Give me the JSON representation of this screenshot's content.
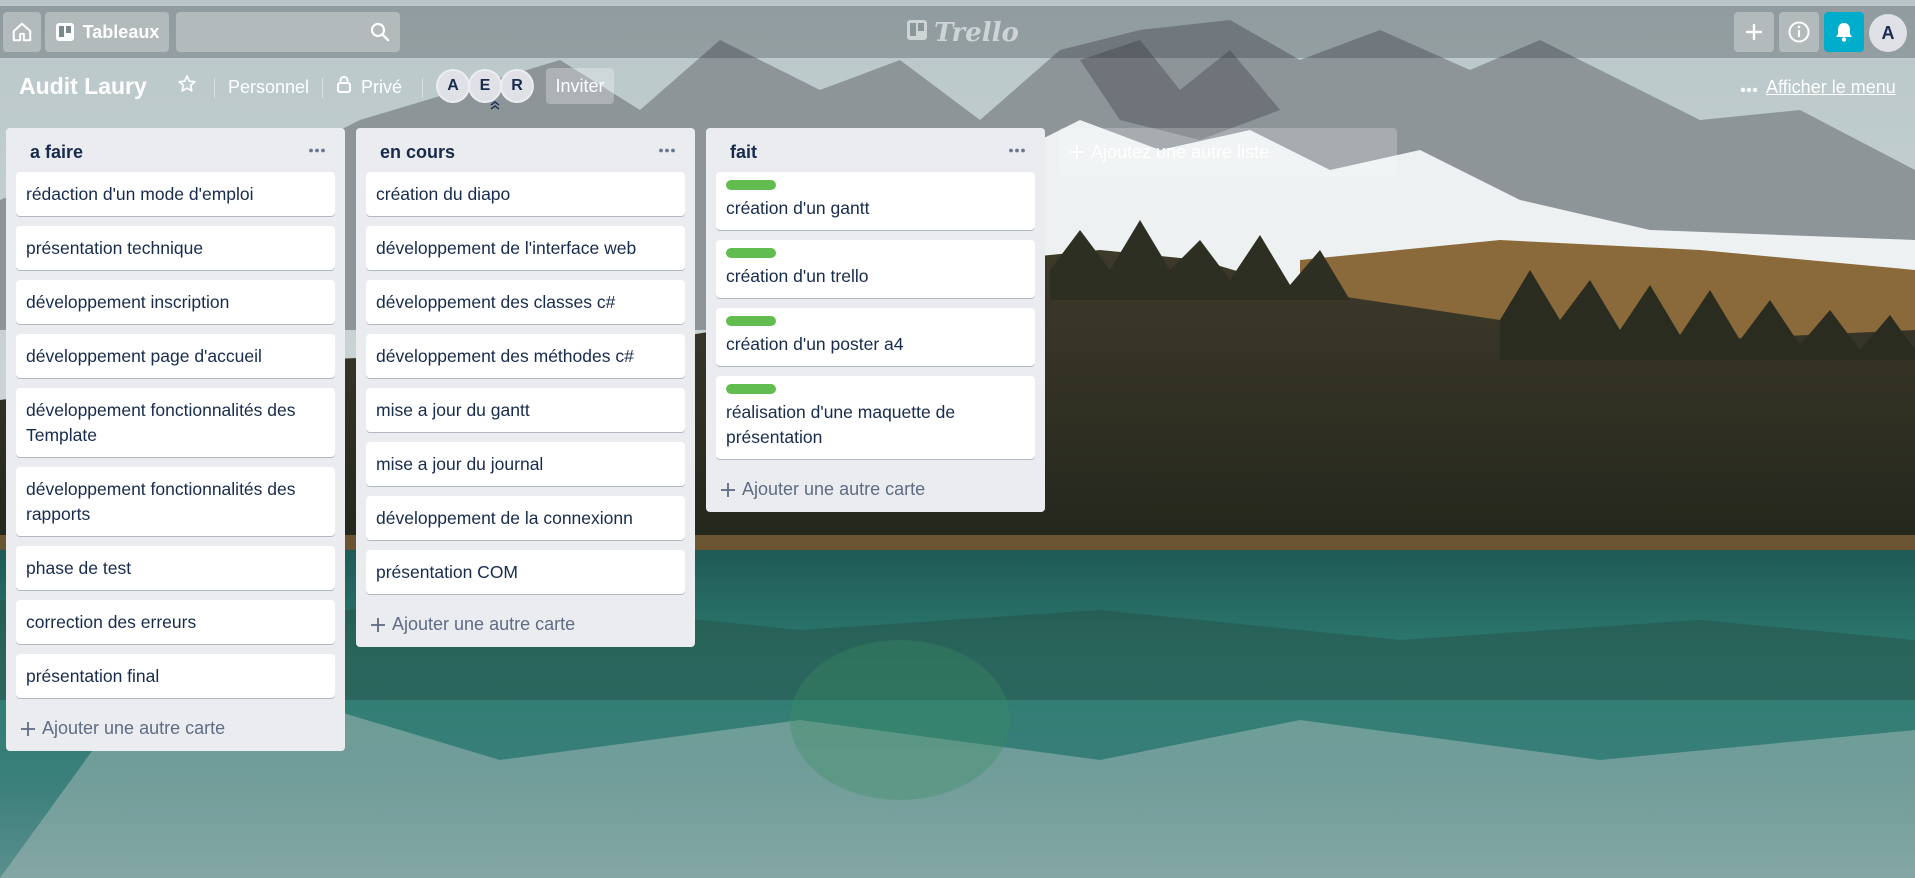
{
  "header": {
    "home_icon": "home-icon",
    "boards_label": "Tableaux",
    "search": {
      "value": "",
      "placeholder": ""
    },
    "logo_text": "Trello",
    "actions": [
      "add-icon",
      "info-icon",
      "bell-icon"
    ],
    "user_initial": "A",
    "accent_notification": "#00aecc"
  },
  "board": {
    "title": "Audit Laury",
    "team": "Personnel",
    "visibility": "Privé",
    "members": [
      "A",
      "E",
      "R"
    ],
    "invite_label": "Inviter",
    "menu_label": "Afficher le menu",
    "add_list_label": "Ajoutez une autre liste"
  },
  "lists": [
    {
      "title": "a faire",
      "cards": [
        {
          "text": "rédaction d'un mode d'emploi"
        },
        {
          "text": "présentation technique"
        },
        {
          "text": "développement inscription"
        },
        {
          "text": "développement page d'accueil"
        },
        {
          "text": "développement fonctionnalités des Template"
        },
        {
          "text": "développement fonctionnalités des rapports"
        },
        {
          "text": "phase de test"
        },
        {
          "text": "correction des erreurs"
        },
        {
          "text": "présentation final"
        }
      ],
      "add_card_label": "Ajouter une autre carte"
    },
    {
      "title": "en cours",
      "cards": [
        {
          "text": "création du diapo"
        },
        {
          "text": "développement de l'interface web"
        },
        {
          "text": "développement des classes c#"
        },
        {
          "text": "développement des méthodes c#"
        },
        {
          "text": "mise a jour du gantt"
        },
        {
          "text": "mise a jour du journal"
        },
        {
          "text": "développement de la connexionn"
        },
        {
          "text": "présentation COM"
        }
      ],
      "add_card_label": "Ajouter une autre carte"
    },
    {
      "title": "fait",
      "cards": [
        {
          "text": "création d'un gantt",
          "label_color": "#61bd4f"
        },
        {
          "text": "création d'un trello",
          "label_color": "#61bd4f"
        },
        {
          "text": "création d'un poster a4",
          "label_color": "#61bd4f"
        },
        {
          "text": "réalisation d'une maquette de présentation",
          "label_color": "#61bd4f"
        }
      ],
      "add_card_label": "Ajouter une autre carte"
    }
  ]
}
